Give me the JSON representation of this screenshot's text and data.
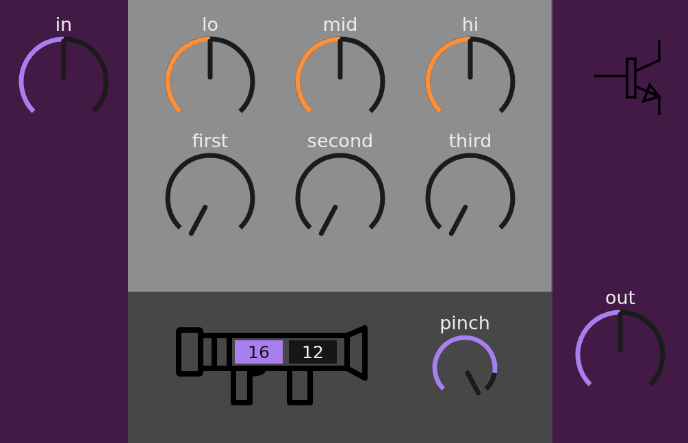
{
  "input": {
    "label": "in"
  },
  "eq": [
    {
      "label": "lo"
    },
    {
      "label": "mid"
    },
    {
      "label": "hi"
    }
  ],
  "tone": [
    {
      "label": "first"
    },
    {
      "label": "second"
    },
    {
      "label": "third"
    }
  ],
  "launcher": {
    "displays": [
      {
        "value": "16",
        "selected": true
      },
      {
        "value": "12",
        "selected": false
      }
    ]
  },
  "pinch": {
    "label": "pinch"
  },
  "output": {
    "label": "out"
  }
}
